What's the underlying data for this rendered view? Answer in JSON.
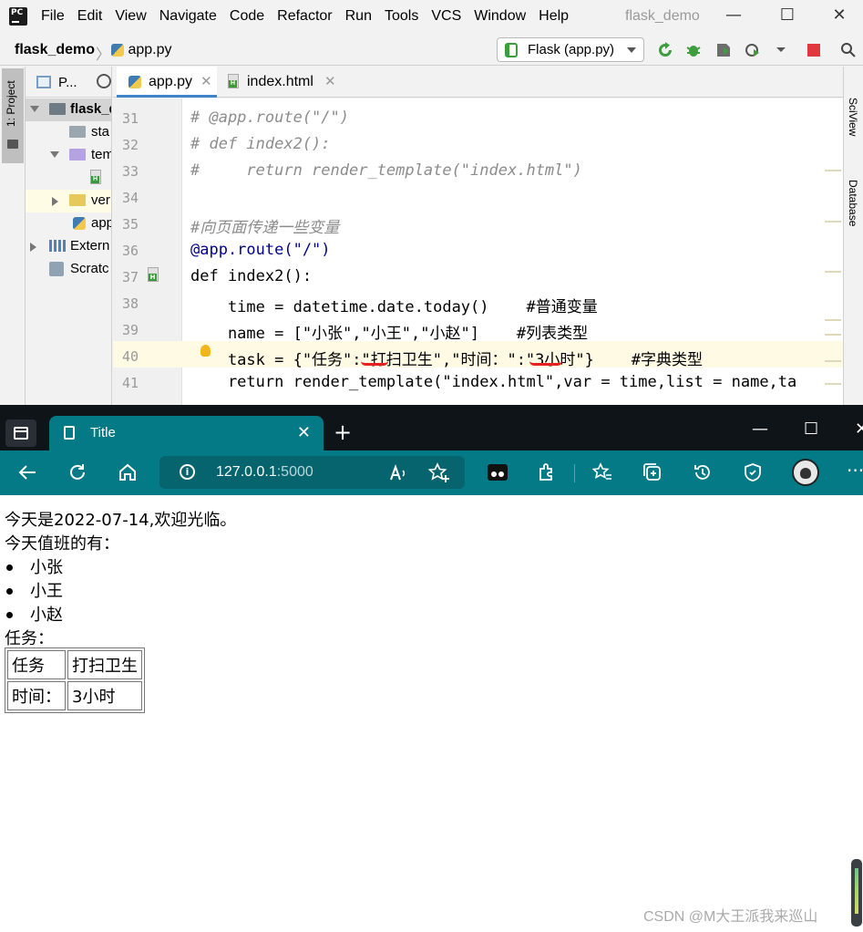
{
  "ide": {
    "logo": "PC",
    "menu": [
      "File",
      "Edit",
      "View",
      "Navigate",
      "Code",
      "Refactor",
      "Run",
      "Tools",
      "VCS",
      "Window",
      "Help"
    ],
    "project_title": "flask_demo",
    "window_controls": [
      "—",
      "☐",
      "✕"
    ],
    "breadcrumb": {
      "project": "flask_demo",
      "separator": "〉",
      "file": "app.py"
    },
    "run_config": "Flask (app.py)",
    "left_tool_tab": "1: Project",
    "project_panel": {
      "header": "P...",
      "rows": [
        {
          "label": "flask_d",
          "bold": true
        },
        {
          "label": "sta"
        },
        {
          "label": "tem"
        },
        {
          "label": ""
        },
        {
          "label": "ver"
        },
        {
          "label": "app"
        },
        {
          "label": "Extern"
        },
        {
          "label": "Scratc"
        }
      ]
    },
    "editor_tabs": [
      {
        "name": "app.py",
        "active": true,
        "close": "✕"
      },
      {
        "name": "index.html",
        "active": false,
        "close": "✕"
      }
    ],
    "line_numbers": [
      "31",
      "32",
      "33",
      "34",
      "35",
      "36",
      "37",
      "38",
      "39",
      "40",
      "41"
    ],
    "code_lines": [
      "# @app.route(\"/\")",
      "# def index2():",
      "#     return render_template(\"index.html\")",
      "",
      "#向页面传递一些变量",
      "@app.route(\"/\")",
      "def index2():",
      "    time = datetime.date.today()    #普通变量",
      "    name = [\"小张\",\"小王\",\"小赵\"]    #列表类型",
      "    task = {\"任务\":\"打扫卫生\",\"时间：\":\"3小时\"}    #字典类型",
      "    return render_template(\"index.html\",var = time,list = name,ta"
    ],
    "right_tool_tabs": [
      "SciView",
      "Database"
    ]
  },
  "browser": {
    "tab_title": "Title",
    "tab_close": "✕",
    "new_tab": "+",
    "window_controls": [
      "—",
      "☐",
      "✕"
    ],
    "address": {
      "host": "127.0.0.1",
      "port": ":5000"
    }
  },
  "page": {
    "greeting": "今天是2022-07-14,欢迎光临。",
    "duty_label": "今天值班的有：",
    "duty_list": [
      "小张",
      "小王",
      "小赵"
    ],
    "task_label": "任务：",
    "task_table": [
      [
        "任务",
        "打扫卫生"
      ],
      [
        "时间：",
        "3小时"
      ]
    ]
  },
  "watermark": "CSDN @M大王派我来巡山"
}
